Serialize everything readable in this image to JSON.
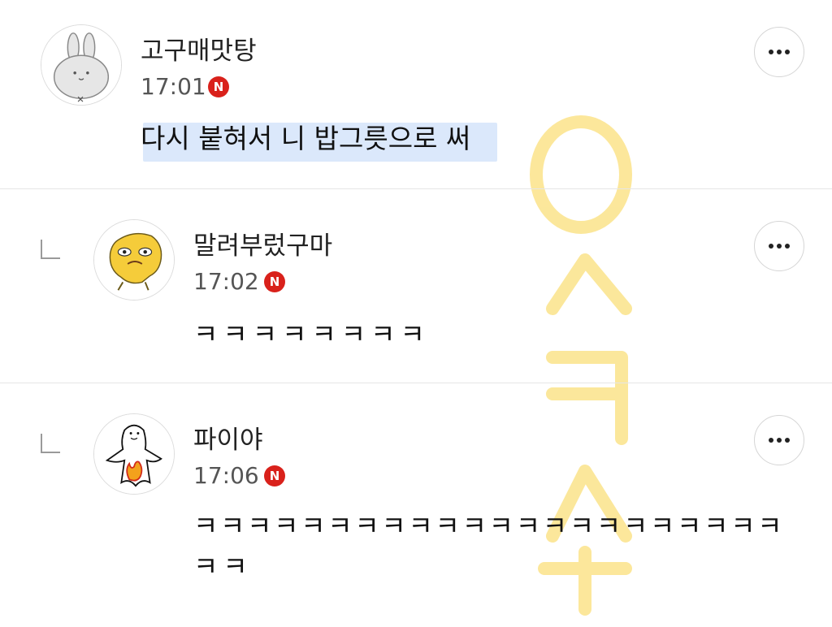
{
  "comments": [
    {
      "nickname": "고구매맛탕",
      "time": "17:01",
      "badge": "N",
      "text": "다시 붙혀서 니 밥그릇으로 써",
      "is_reply": false,
      "avatar": "rabbit-avatar"
    },
    {
      "nickname": "말려부렀구마",
      "time": "17:02",
      "badge": "N",
      "text": "ㅋㅋㅋㅋㅋㅋㅋㅋ",
      "is_reply": true,
      "avatar": "yellow-character-avatar"
    },
    {
      "nickname": "파이야",
      "time": "17:06",
      "badge": "N",
      "text_line1": "ㅋㅋㅋㅋㅋㅋㅋㅋㅋㅋㅋㅋㅋㅋㅋㅋㅋㅋㅋㅋㅋㅋ",
      "text_line2": "ㅋㅋ",
      "is_reply": true,
      "avatar": "ghost-fire-avatar"
    }
  ],
  "icons": {
    "more": "more-dots-icon",
    "reply": "reply-arrow-icon"
  },
  "colors": {
    "badge": "#d9211b",
    "highlight": "#dbe8fb",
    "watermark": "#fbe38a"
  }
}
